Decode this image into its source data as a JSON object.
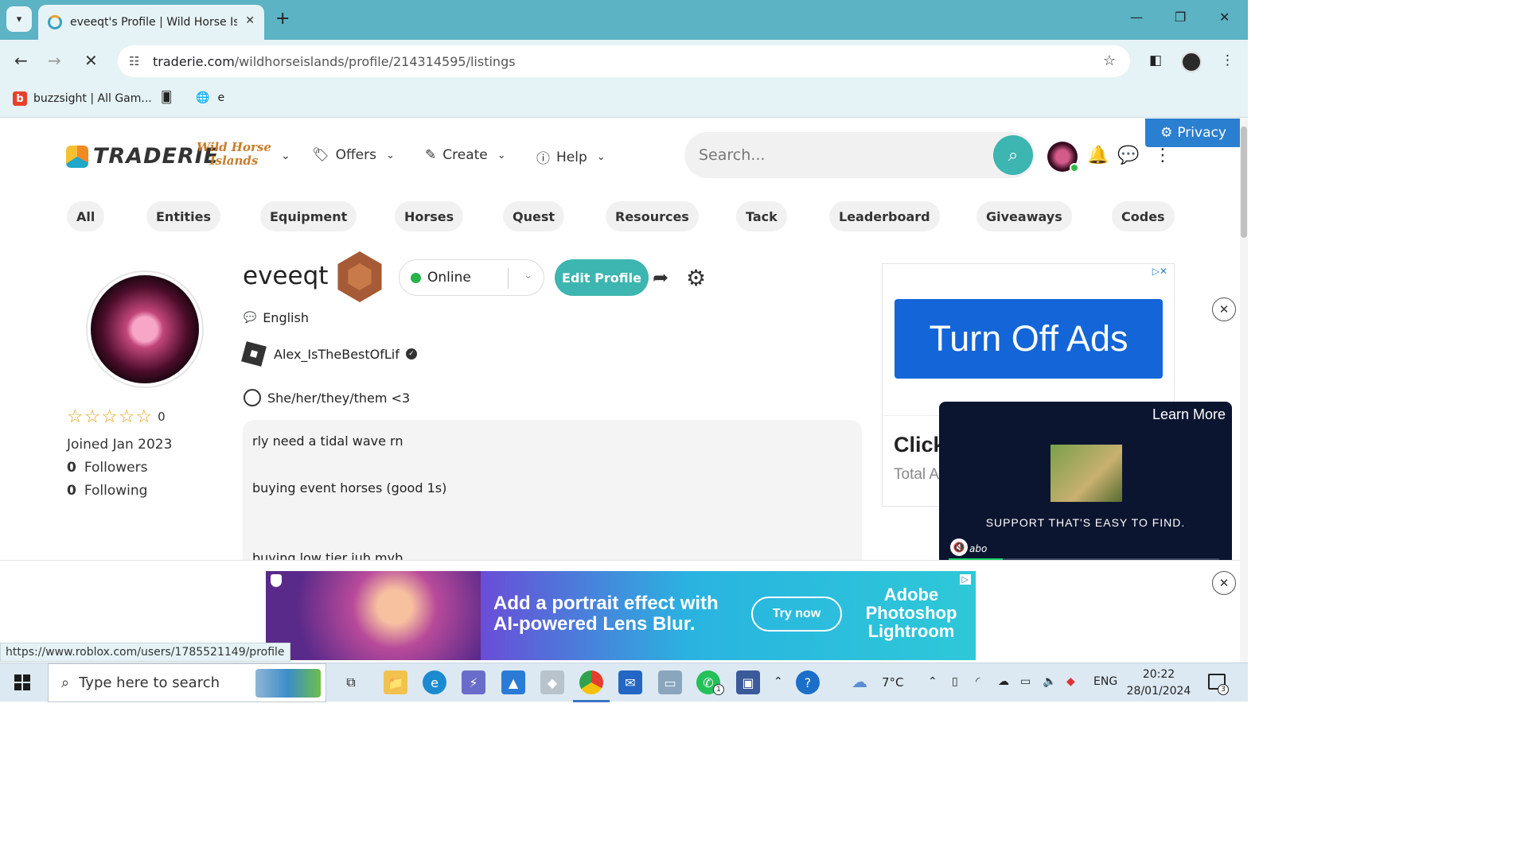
{
  "browser": {
    "tab_title": "eveeqt's Profile | Wild Horse Isl",
    "url_host": "traderie.com",
    "url_path": "/wildhorseislands/profile/214314595/listings",
    "bookmarks": [
      {
        "label": "buzzsight | All Gam..."
      },
      {
        "label": ""
      },
      {
        "label": "e"
      }
    ],
    "status_link": "https://www.roblox.com/users/1785521149/profile"
  },
  "site": {
    "logo_text": "TRADERIE",
    "game_logo_line1": "Wild Horse",
    "game_logo_line2": "Islands",
    "menu": [
      {
        "label": "Offers",
        "icon": "tag-icon"
      },
      {
        "label": "Create",
        "icon": "edit-icon"
      },
      {
        "label": "Help",
        "icon": "info-icon"
      }
    ],
    "search_placeholder": "Search...",
    "privacy_label": "Privacy",
    "categories": [
      "All",
      "Entities",
      "Equipment",
      "Horses",
      "Quest",
      "Resources",
      "Tack",
      "Leaderboard",
      "Giveaways",
      "Codes"
    ],
    "accent_color": "#3db5b0"
  },
  "profile": {
    "username": "eveeqt",
    "status": "Online",
    "edit_label": "Edit Profile",
    "language": "English",
    "roblox_name": "Alex_IsTheBestOfLif",
    "pronouns": "She/her/they/them <3",
    "rating_count": "0",
    "rating_stars": 0,
    "joined": "Joined Jan 2023",
    "followers_count": "0",
    "followers_label": "Followers",
    "following_count": "0",
    "following_label": "Following",
    "bio_lines": [
      "rly need a tidal wave rn",
      "buying event horses (good 1s)",
      "buying low tier iuh myb"
    ]
  },
  "ads": {
    "turn_off": "Turn Off Ads",
    "click_text": "Click",
    "total_text": "Total A",
    "video_learn": "Learn More",
    "video_text": "SUPPORT THAT'S EASY TO FIND.",
    "video_logo": "abo",
    "video_progress": 0.2,
    "banner_headline1": "Add a portrait effect with",
    "banner_headline2": "AI-powered Lens Blur.",
    "banner_cta": "Try now",
    "banner_brand1": "Adobe",
    "banner_brand2": "Photoshop",
    "banner_brand3": "Lightroom"
  },
  "taskbar": {
    "search_placeholder": "Type here to search",
    "weather": "7°C",
    "language": "ENG",
    "time": "20:22",
    "date": "28/01/2024",
    "notif_count": "3",
    "whatsapp_badge": "1"
  }
}
